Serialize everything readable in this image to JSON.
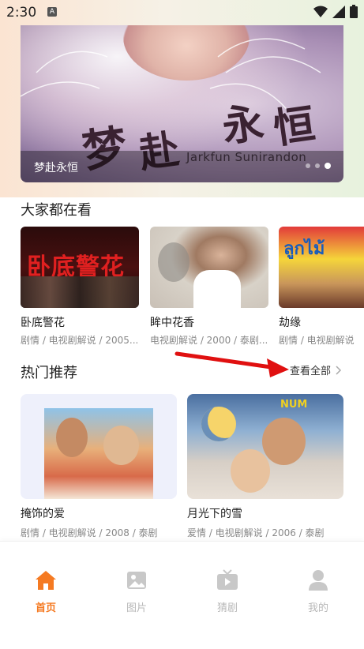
{
  "status_bar": {
    "time": "2:30",
    "indicator": "A"
  },
  "banner": {
    "calligraphy_1": "梦",
    "calligraphy_2": "赴",
    "calligraphy_3": "永",
    "calligraphy_4": "恒",
    "credit": "Jarkfun  Sunirandon",
    "caption": "梦赴永恒",
    "slide_count": 3,
    "active_slide": 3
  },
  "section_watching": {
    "title": "大家都在看",
    "items": [
      {
        "title": "卧底警花",
        "meta": "剧情 / 电视剧解说 / 2005...",
        "poster_text": "卧底警花"
      },
      {
        "title": "眸中花香",
        "meta": "电视剧解说 / 2000 / 泰剧..."
      },
      {
        "title": "劫缘",
        "meta": "剧情 / 电视剧解说",
        "poster_text": "ลูกไม้"
      }
    ]
  },
  "section_hot": {
    "title": "热门推荐",
    "see_all": "查看全部",
    "items": [
      {
        "title": "掩饰的爱",
        "meta": "剧情 / 电视剧解说 / 2008 / 泰剧"
      },
      {
        "title": "月光下的雪",
        "meta": "爱情 / 电视剧解说 / 2006 / 泰剧",
        "poster_text": "NUM"
      }
    ]
  },
  "tab_bar": {
    "tabs": [
      {
        "label": "首页",
        "icon": "home-icon",
        "active": true
      },
      {
        "label": "图片",
        "icon": "image-icon",
        "active": false
      },
      {
        "label": "猜剧",
        "icon": "tv-icon",
        "active": false
      },
      {
        "label": "我的",
        "icon": "user-icon",
        "active": false
      }
    ]
  },
  "colors": {
    "accent": "#f57a22",
    "inactive_tab": "#b8b8b8",
    "annotation_arrow": "#e01010"
  }
}
